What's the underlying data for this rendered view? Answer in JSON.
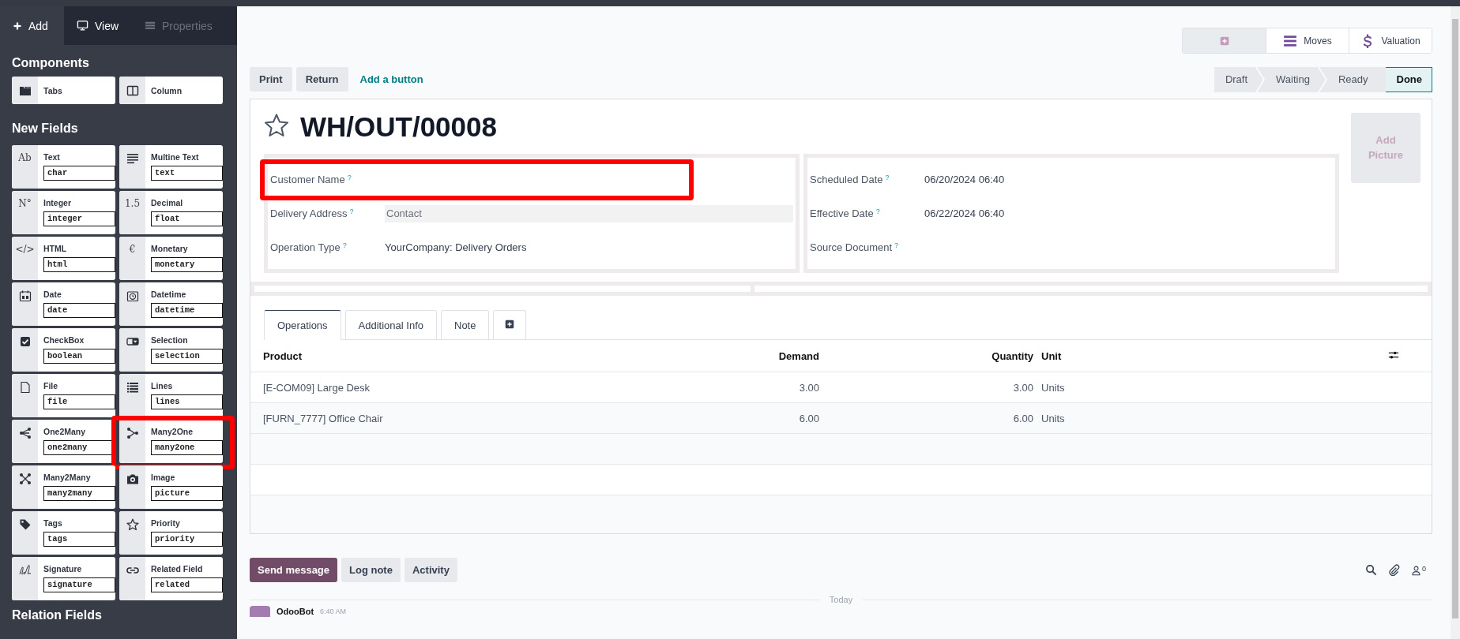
{
  "sidebar": {
    "tabs": [
      {
        "label": "Add",
        "selected": true,
        "disabled": false
      },
      {
        "label": "View",
        "selected": false,
        "disabled": false
      },
      {
        "label": "Properties",
        "selected": false,
        "disabled": true
      }
    ],
    "components": {
      "heading": "Components",
      "items": [
        {
          "label": "Tabs"
        },
        {
          "label": "Column"
        }
      ]
    },
    "new_fields": {
      "heading": "New Fields",
      "items": [
        {
          "label": "Text",
          "type": "char",
          "glyph": "Ab",
          "highlighted": false
        },
        {
          "label": "Multine Text",
          "type": "text",
          "highlighted": false
        },
        {
          "label": "Integer",
          "type": "integer",
          "glyph": "N°",
          "highlighted": false
        },
        {
          "label": "Decimal",
          "type": "float",
          "glyph": "1.5",
          "highlighted": false
        },
        {
          "label": "HTML",
          "type": "html",
          "glyph": "</>",
          "highlighted": false
        },
        {
          "label": "Monetary",
          "type": "monetary",
          "glyph": "€",
          "highlighted": false
        },
        {
          "label": "Date",
          "type": "date",
          "highlighted": false
        },
        {
          "label": "Datetime",
          "type": "datetime",
          "highlighted": false
        },
        {
          "label": "CheckBox",
          "type": "boolean",
          "highlighted": false
        },
        {
          "label": "Selection",
          "type": "selection",
          "highlighted": false
        },
        {
          "label": "File",
          "type": "file",
          "highlighted": false
        },
        {
          "label": "Lines",
          "type": "lines",
          "highlighted": false
        },
        {
          "label": "One2Many",
          "type": "one2many",
          "highlighted": false
        },
        {
          "label": "Many2One",
          "type": "many2one",
          "highlighted": true
        },
        {
          "label": "Many2Many",
          "type": "many2many",
          "highlighted": false
        },
        {
          "label": "Image",
          "type": "picture",
          "highlighted": false
        },
        {
          "label": "Tags",
          "type": "tags",
          "highlighted": false
        },
        {
          "label": "Priority",
          "type": "priority",
          "highlighted": false
        },
        {
          "label": "Signature",
          "type": "signature",
          "highlighted": false
        },
        {
          "label": "Related Field",
          "type": "related",
          "highlighted": false
        }
      ]
    },
    "relation_fields": {
      "heading": "Relation Fields"
    }
  },
  "smart_buttons": [
    {
      "kind": "add"
    },
    {
      "kind": "stat",
      "label": "Moves"
    },
    {
      "kind": "stat",
      "label": "Valuation"
    }
  ],
  "header_buttons": [
    {
      "kind": "button",
      "label": "Print"
    },
    {
      "kind": "button",
      "label": "Return"
    },
    {
      "kind": "link",
      "label": "Add a button"
    }
  ],
  "status_steps": [
    {
      "label": "Draft",
      "selected": false
    },
    {
      "label": "Waiting",
      "selected": false
    },
    {
      "label": "Ready",
      "selected": false
    },
    {
      "label": "Done",
      "selected": true
    }
  ],
  "record": {
    "title": "WH/OUT/00008",
    "starred": false,
    "add_picture": "Add Picture",
    "fields_left": [
      {
        "label": "Customer Name",
        "help": "?",
        "highlighted": true
      },
      {
        "label": "Delivery Address",
        "help": "?",
        "placeholder": "Contact",
        "highlighted": false
      },
      {
        "label": "Operation Type",
        "help": "?",
        "value": "YourCompany: Delivery Orders",
        "highlighted": false
      }
    ],
    "fields_right": [
      {
        "label": "Scheduled Date",
        "help": "?",
        "value": "06/20/2024 06:40",
        "highlighted": false
      },
      {
        "label": "Effective Date",
        "help": "?",
        "value": "06/22/2024 06:40",
        "highlighted": false
      },
      {
        "label": "Source Document",
        "help": "?",
        "highlighted": false
      }
    ]
  },
  "notebook": {
    "tabs": [
      {
        "kind": "tab",
        "label": "Operations",
        "selected": true
      },
      {
        "kind": "tab",
        "label": "Additional Info",
        "selected": false
      },
      {
        "kind": "tab",
        "label": "Note",
        "selected": false
      },
      {
        "kind": "add",
        "selected": false
      }
    ]
  },
  "table": {
    "columns": [
      {
        "label": "Product"
      },
      {
        "label": "Demand"
      },
      {
        "label": "Quantity"
      },
      {
        "label": "Unit"
      }
    ],
    "rows": [
      [
        "[E-COM09] Large Desk",
        "3.00",
        "3.00",
        "Units"
      ],
      [
        "[FURN_7777] Office Chair",
        "6.00",
        "6.00",
        "Units"
      ]
    ]
  },
  "chatter": {
    "buttons": [
      {
        "label": "Send message",
        "primary": true
      },
      {
        "label": "Log note",
        "primary": false
      },
      {
        "label": "Activity",
        "primary": false
      }
    ],
    "followers_count": "0",
    "divider": "Today",
    "message": {
      "author": "OdooBot",
      "time": "6:40 AM"
    }
  }
}
